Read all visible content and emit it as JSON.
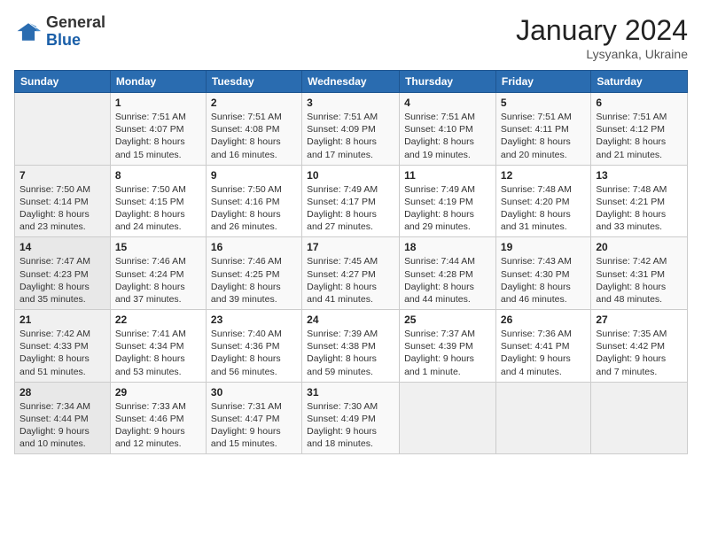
{
  "header": {
    "logo_general": "General",
    "logo_blue": "Blue",
    "month_title": "January 2024",
    "location": "Lysyanka, Ukraine"
  },
  "days_of_week": [
    "Sunday",
    "Monday",
    "Tuesday",
    "Wednesday",
    "Thursday",
    "Friday",
    "Saturday"
  ],
  "weeks": [
    [
      {
        "day": "",
        "info": ""
      },
      {
        "day": "1",
        "info": "Sunrise: 7:51 AM\nSunset: 4:07 PM\nDaylight: 8 hours\nand 15 minutes."
      },
      {
        "day": "2",
        "info": "Sunrise: 7:51 AM\nSunset: 4:08 PM\nDaylight: 8 hours\nand 16 minutes."
      },
      {
        "day": "3",
        "info": "Sunrise: 7:51 AM\nSunset: 4:09 PM\nDaylight: 8 hours\nand 17 minutes."
      },
      {
        "day": "4",
        "info": "Sunrise: 7:51 AM\nSunset: 4:10 PM\nDaylight: 8 hours\nand 19 minutes."
      },
      {
        "day": "5",
        "info": "Sunrise: 7:51 AM\nSunset: 4:11 PM\nDaylight: 8 hours\nand 20 minutes."
      },
      {
        "day": "6",
        "info": "Sunrise: 7:51 AM\nSunset: 4:12 PM\nDaylight: 8 hours\nand 21 minutes."
      }
    ],
    [
      {
        "day": "7",
        "info": "Sunrise: 7:50 AM\nSunset: 4:14 PM\nDaylight: 8 hours\nand 23 minutes."
      },
      {
        "day": "8",
        "info": "Sunrise: 7:50 AM\nSunset: 4:15 PM\nDaylight: 8 hours\nand 24 minutes."
      },
      {
        "day": "9",
        "info": "Sunrise: 7:50 AM\nSunset: 4:16 PM\nDaylight: 8 hours\nand 26 minutes."
      },
      {
        "day": "10",
        "info": "Sunrise: 7:49 AM\nSunset: 4:17 PM\nDaylight: 8 hours\nand 27 minutes."
      },
      {
        "day": "11",
        "info": "Sunrise: 7:49 AM\nSunset: 4:19 PM\nDaylight: 8 hours\nand 29 minutes."
      },
      {
        "day": "12",
        "info": "Sunrise: 7:48 AM\nSunset: 4:20 PM\nDaylight: 8 hours\nand 31 minutes."
      },
      {
        "day": "13",
        "info": "Sunrise: 7:48 AM\nSunset: 4:21 PM\nDaylight: 8 hours\nand 33 minutes."
      }
    ],
    [
      {
        "day": "14",
        "info": "Sunrise: 7:47 AM\nSunset: 4:23 PM\nDaylight: 8 hours\nand 35 minutes."
      },
      {
        "day": "15",
        "info": "Sunrise: 7:46 AM\nSunset: 4:24 PM\nDaylight: 8 hours\nand 37 minutes."
      },
      {
        "day": "16",
        "info": "Sunrise: 7:46 AM\nSunset: 4:25 PM\nDaylight: 8 hours\nand 39 minutes."
      },
      {
        "day": "17",
        "info": "Sunrise: 7:45 AM\nSunset: 4:27 PM\nDaylight: 8 hours\nand 41 minutes."
      },
      {
        "day": "18",
        "info": "Sunrise: 7:44 AM\nSunset: 4:28 PM\nDaylight: 8 hours\nand 44 minutes."
      },
      {
        "day": "19",
        "info": "Sunrise: 7:43 AM\nSunset: 4:30 PM\nDaylight: 8 hours\nand 46 minutes."
      },
      {
        "day": "20",
        "info": "Sunrise: 7:42 AM\nSunset: 4:31 PM\nDaylight: 8 hours\nand 48 minutes."
      }
    ],
    [
      {
        "day": "21",
        "info": "Sunrise: 7:42 AM\nSunset: 4:33 PM\nDaylight: 8 hours\nand 51 minutes."
      },
      {
        "day": "22",
        "info": "Sunrise: 7:41 AM\nSunset: 4:34 PM\nDaylight: 8 hours\nand 53 minutes."
      },
      {
        "day": "23",
        "info": "Sunrise: 7:40 AM\nSunset: 4:36 PM\nDaylight: 8 hours\nand 56 minutes."
      },
      {
        "day": "24",
        "info": "Sunrise: 7:39 AM\nSunset: 4:38 PM\nDaylight: 8 hours\nand 59 minutes."
      },
      {
        "day": "25",
        "info": "Sunrise: 7:37 AM\nSunset: 4:39 PM\nDaylight: 9 hours\nand 1 minute."
      },
      {
        "day": "26",
        "info": "Sunrise: 7:36 AM\nSunset: 4:41 PM\nDaylight: 9 hours\nand 4 minutes."
      },
      {
        "day": "27",
        "info": "Sunrise: 7:35 AM\nSunset: 4:42 PM\nDaylight: 9 hours\nand 7 minutes."
      }
    ],
    [
      {
        "day": "28",
        "info": "Sunrise: 7:34 AM\nSunset: 4:44 PM\nDaylight: 9 hours\nand 10 minutes."
      },
      {
        "day": "29",
        "info": "Sunrise: 7:33 AM\nSunset: 4:46 PM\nDaylight: 9 hours\nand 12 minutes."
      },
      {
        "day": "30",
        "info": "Sunrise: 7:31 AM\nSunset: 4:47 PM\nDaylight: 9 hours\nand 15 minutes."
      },
      {
        "day": "31",
        "info": "Sunrise: 7:30 AM\nSunset: 4:49 PM\nDaylight: 9 hours\nand 18 minutes."
      },
      {
        "day": "",
        "info": ""
      },
      {
        "day": "",
        "info": ""
      },
      {
        "day": "",
        "info": ""
      }
    ]
  ]
}
